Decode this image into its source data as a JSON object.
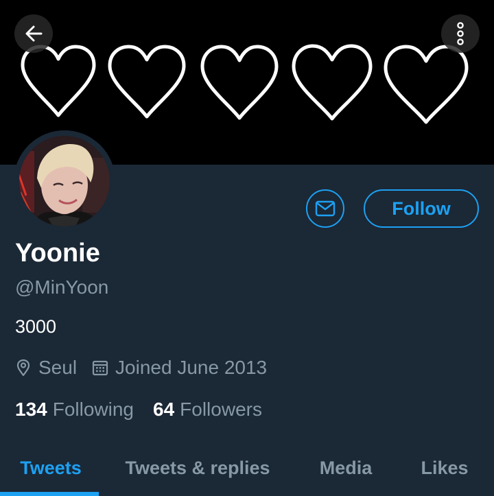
{
  "profile": {
    "name": "Yoonie",
    "handle": "@MinYoon",
    "bio": "3000",
    "location": "Seul",
    "joined": "Joined June 2013"
  },
  "actions": {
    "follow_label": "Follow"
  },
  "stats": {
    "following_count": "134",
    "following_label": "Following",
    "followers_count": "64",
    "followers_label": "Followers"
  },
  "tabs": [
    {
      "label": "Tweets",
      "active": true
    },
    {
      "label": "Tweets & replies",
      "active": false
    },
    {
      "label": "Media",
      "active": false
    },
    {
      "label": "Likes",
      "active": false
    }
  ],
  "icons": {
    "back": "arrow-left-icon",
    "more": "more-vertical-icon",
    "message": "envelope-icon",
    "location": "location-pin-icon",
    "calendar": "calendar-icon"
  },
  "colors": {
    "accent": "#1da1f2",
    "background": "#1b2836",
    "banner": "#000000",
    "secondary_text": "#8899a6"
  }
}
